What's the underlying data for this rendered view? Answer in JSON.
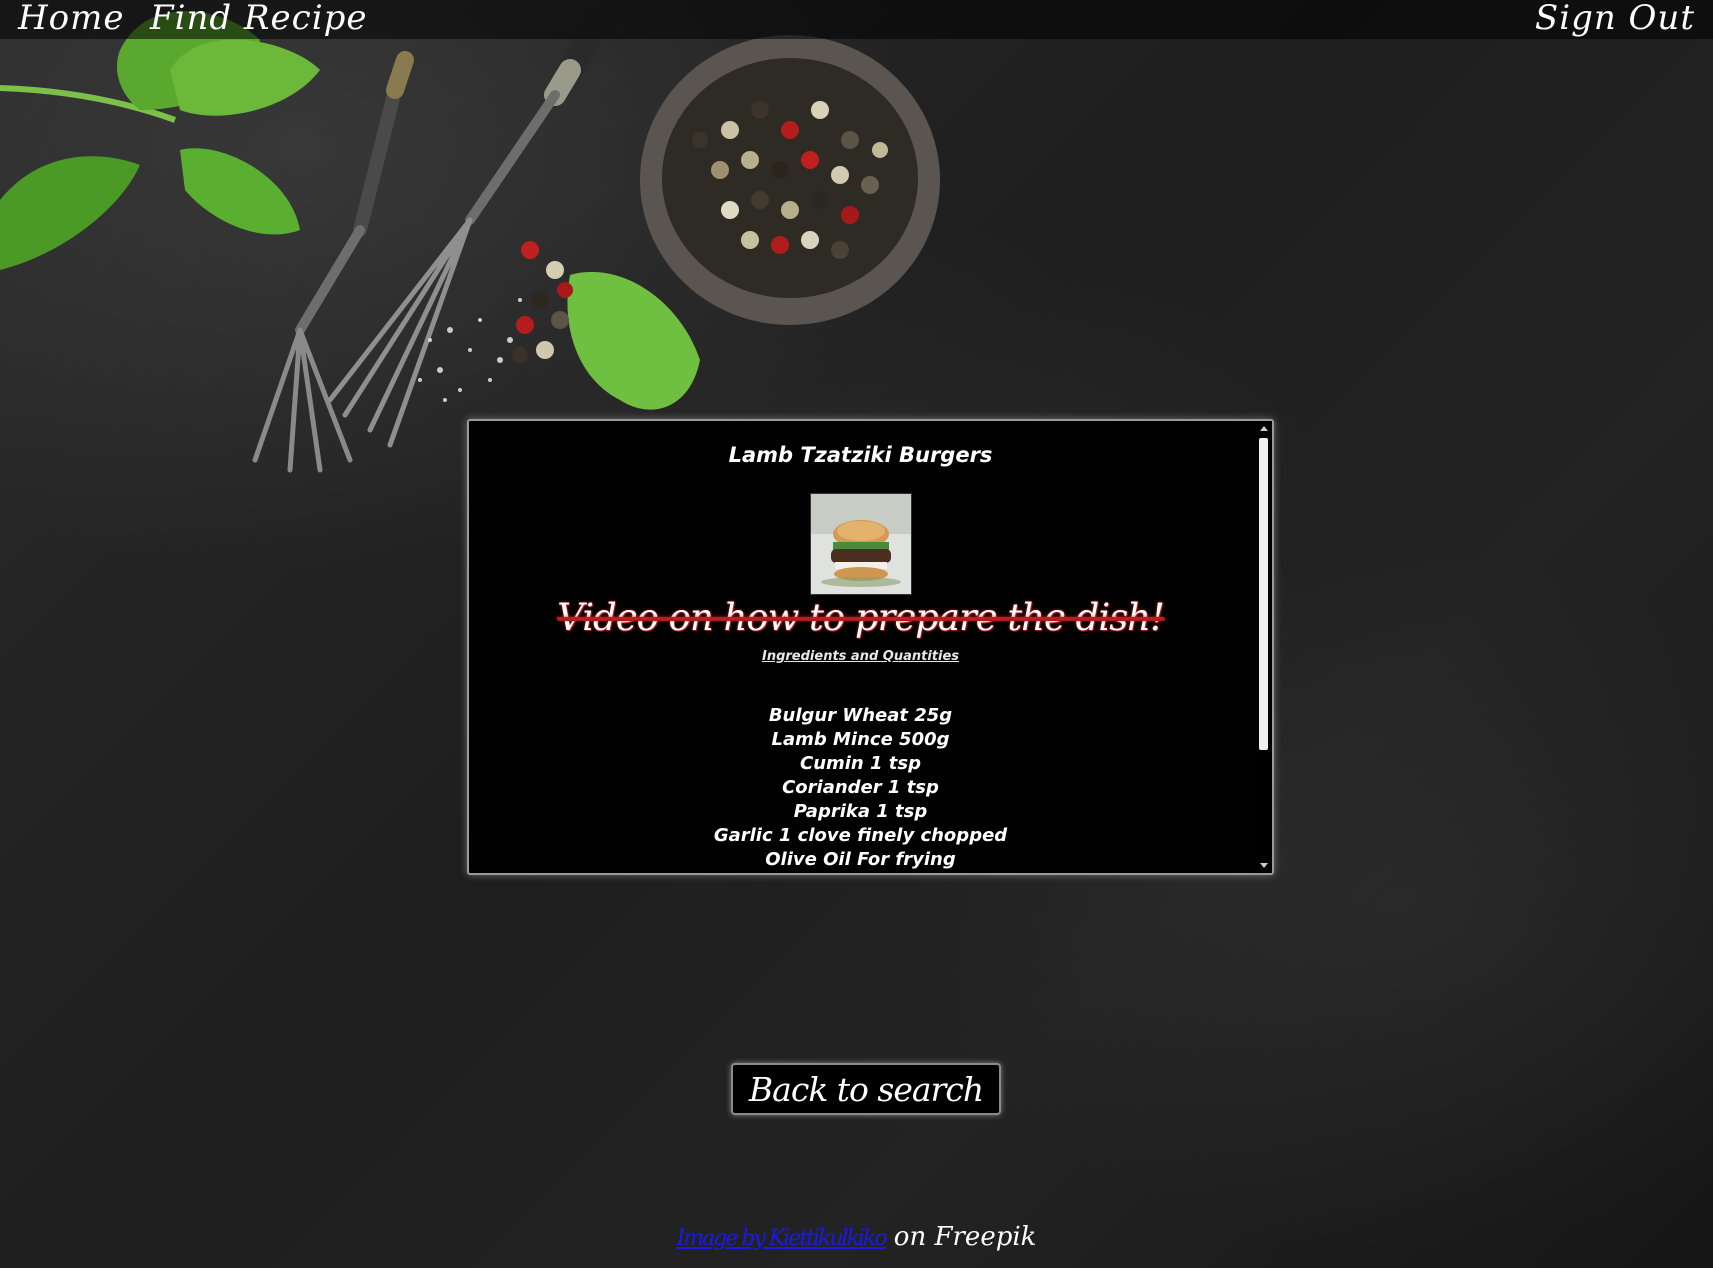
{
  "nav": {
    "home": "Home",
    "find_recipe": "Find Recipe",
    "sign_out": "Sign Out"
  },
  "recipe": {
    "title": "Lamb Tzatziki Burgers",
    "image_alt": "burger photo",
    "video_link": "Video on how to prepare the dish!",
    "ingredients_heading": "Ingredients and Quantities",
    "ingredients": [
      "Bulgur Wheat 25g",
      "Lamb Mince 500g",
      "Cumin 1 tsp",
      "Coriander 1 tsp",
      "Paprika 1 tsp",
      "Garlic 1 clove finely chopped",
      "Olive Oil For frying"
    ]
  },
  "back_button": "Back to search",
  "footer": {
    "credit_link": "Image by Kiettikulkiko",
    "credit_suffix": " on Freepik"
  },
  "colors": {
    "video_link_accent": "#c02020",
    "credit_link": "#1a1ae6",
    "panel_bg": "#000000"
  }
}
